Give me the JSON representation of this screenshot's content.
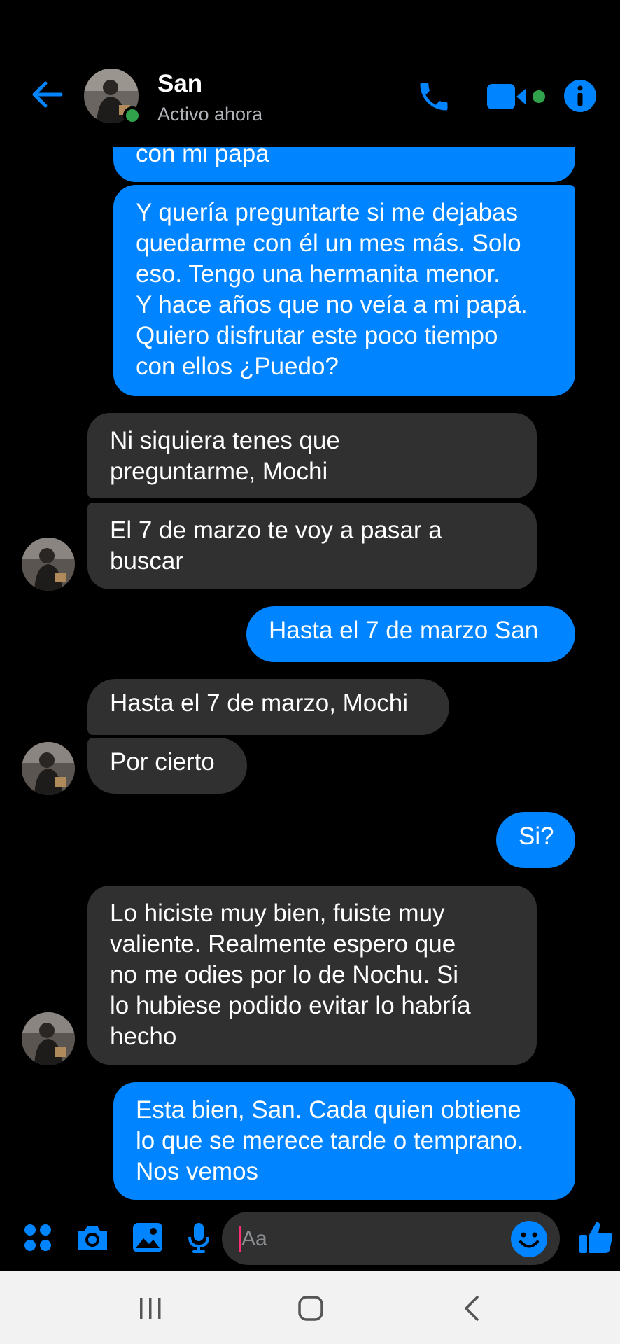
{
  "header": {
    "contact_name": "San",
    "status": "Activo ahora",
    "icons": [
      "back-arrow-icon",
      "phone-icon",
      "video-camera-icon",
      "info-icon"
    ],
    "accent_color": "#0084ff",
    "online_color": "#31a24c"
  },
  "messages": [
    {
      "sender": "me",
      "text": "con mi papá"
    },
    {
      "sender": "me",
      "text": "Y quería preguntarte si me dejabas\nquedarme con él un mes más. Solo\neso. Tengo una hermanita menor.\nY hace años que no veía a mi papá.\nQuiero disfrutar este poco tiempo\ncon ellos ¿Puedo?"
    },
    {
      "sender": "them",
      "text": "Ni siquiera tenes que\npreguntarme, Mochi"
    },
    {
      "sender": "them",
      "text": "El 7 de marzo te voy a pasar a\nbuscar"
    },
    {
      "sender": "me",
      "text": "Hasta el 7 de marzo San"
    },
    {
      "sender": "them",
      "text": "Hasta el 7 de marzo, Mochi"
    },
    {
      "sender": "them",
      "text": "Por cierto"
    },
    {
      "sender": "me",
      "text": "Si?"
    },
    {
      "sender": "them",
      "text": "Lo hiciste muy bien, fuiste muy\nvaliente. Realmente espero que\nno me odies por lo de Nochu. Si\nlo hubiese podido evitar lo habría\nhecho"
    },
    {
      "sender": "me",
      "text": "Esta bien, San. Cada quien obtiene\nlo que se merece tarde o temprano.\nNos vemos"
    }
  ],
  "composer": {
    "placeholder": "Aa",
    "icons": [
      "apps-grid-icon",
      "camera-icon",
      "gallery-icon",
      "microphone-icon",
      "emoji-icon",
      "thumbs-up-icon"
    ]
  },
  "nav": {
    "icons": [
      "recent-apps-icon",
      "home-icon",
      "back-icon"
    ]
  },
  "colors": {
    "my_bubble": "#0084ff",
    "their_bubble": "#303030",
    "background": "#000000"
  }
}
